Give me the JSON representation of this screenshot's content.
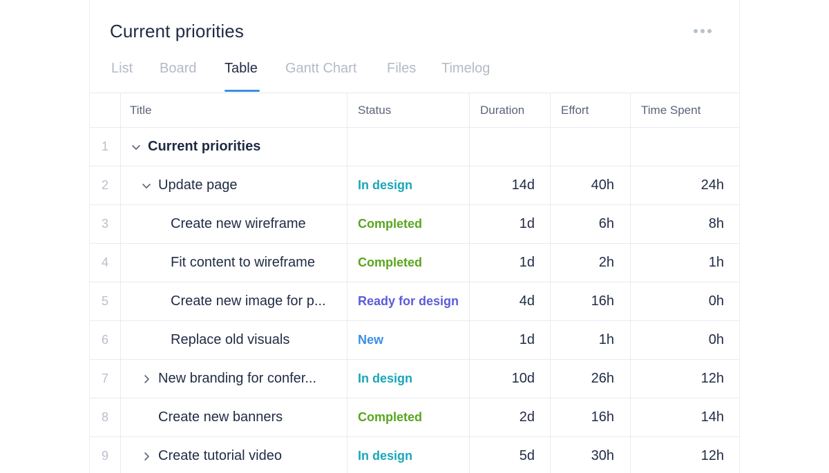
{
  "panel": {
    "title": "Current priorities",
    "more_icon": "more-horizontal-icon"
  },
  "tabs": [
    {
      "label": "List",
      "active": false
    },
    {
      "label": "Board",
      "active": false
    },
    {
      "label": "Table",
      "active": true
    },
    {
      "label": "Gantt Chart",
      "active": false
    },
    {
      "label": "Files",
      "active": false
    },
    {
      "label": "Timelog",
      "active": false
    }
  ],
  "colors": {
    "accent": "#3a8ee6",
    "status_in_design": "#18a7b8",
    "status_completed": "#5aa51d",
    "status_ready_for_design": "#5b5bdc",
    "status_new": "#3a8ee6"
  },
  "table": {
    "columns": [
      "Title",
      "Status",
      "Duration",
      "Effort",
      "Time Spent"
    ],
    "rows": [
      {
        "num": "1",
        "title": "Current priorities",
        "status": "",
        "duration": "",
        "effort": "",
        "spent": "",
        "expander": "chevron-down-icon"
      },
      {
        "num": "2",
        "title": "Update page",
        "status": "In design",
        "duration": "14d",
        "effort": "40h",
        "spent": "24h",
        "expander": "chevron-down-icon"
      },
      {
        "num": "3",
        "title": "Create new wireframe",
        "status": "Completed",
        "duration": "1d",
        "effort": "6h",
        "spent": "8h",
        "expander": ""
      },
      {
        "num": "4",
        "title": "Fit content to wireframe",
        "status": "Completed",
        "duration": "1d",
        "effort": "2h",
        "spent": "1h",
        "expander": ""
      },
      {
        "num": "5",
        "title": "Create new image for p...",
        "status": "Ready for design",
        "duration": "4d",
        "effort": "16h",
        "spent": "0h",
        "expander": ""
      },
      {
        "num": "6",
        "title": "Replace old visuals",
        "status": "New",
        "duration": "1d",
        "effort": "1h",
        "spent": "0h",
        "expander": ""
      },
      {
        "num": "7",
        "title": "New branding for confer...",
        "status": "In design",
        "duration": "10d",
        "effort": "26h",
        "spent": "12h",
        "expander": "chevron-right-icon"
      },
      {
        "num": "8",
        "title": "Create new banners",
        "status": "Completed",
        "duration": "2d",
        "effort": "16h",
        "spent": "14h",
        "expander": ""
      },
      {
        "num": "9",
        "title": "Create tutorial video",
        "status": "In design",
        "duration": "5d",
        "effort": "30h",
        "spent": "12h",
        "expander": "chevron-right-icon"
      }
    ]
  }
}
